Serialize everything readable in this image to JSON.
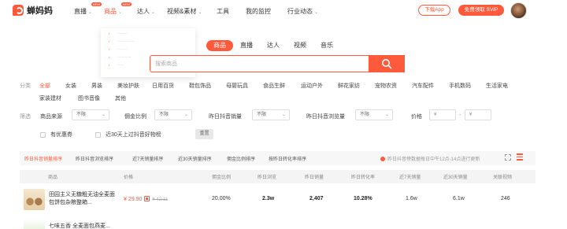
{
  "brand": {
    "name": "蝉妈妈",
    "accent": "#fe5a3b"
  },
  "nav": {
    "items": [
      {
        "label": "直播",
        "badge": "NEW"
      },
      {
        "label": "商品",
        "badge": "NEW"
      },
      {
        "label": "达人",
        "badge": ""
      },
      {
        "label": "视频&素材",
        "badge": ""
      },
      {
        "label": "工具",
        "badge": ""
      },
      {
        "label": "我的监控",
        "badge": ""
      },
      {
        "label": "行业动态",
        "badge": ""
      }
    ],
    "download_label": "下载App",
    "vip_label": "免费领取 SVIP"
  },
  "search": {
    "tabs": [
      "商品",
      "直播",
      "达人",
      "视频",
      "音乐"
    ],
    "placeholder": "搜索商品"
  },
  "category": {
    "label": "分类",
    "items": [
      "全部",
      "女装",
      "男装",
      "美妆护肤",
      "日用百货",
      "鞋包饰品",
      "母婴玩具",
      "食品生鲜",
      "运动户外",
      "鲜花家纺",
      "宠物农资",
      "汽车配件",
      "手机数码",
      "生活家电",
      "家装建材",
      "图书音像",
      "其他"
    ]
  },
  "filters": {
    "label": "筛选",
    "source_label": "商品来源",
    "source_value": "不限",
    "commission_label": "佣金比例",
    "commission_value": "不限",
    "sales_label": "昨日抖音销量",
    "sales_value": "不限",
    "views_label": "昨日抖音浏览量",
    "views_value": "不限",
    "price_label": "价格",
    "price_min": "¥",
    "price_max": "¥",
    "coupon_label": "有优惠券",
    "hot_label": "近30天上过抖音好物榜",
    "reset_label": "重置"
  },
  "sort": {
    "tabs": [
      "昨日抖音销量排序",
      "昨日抖音浏览排序",
      "近7天销量排序",
      "近30天销量排序",
      "佣金比例排序",
      "按昨日转化率排序"
    ],
    "note": "昨日抖音榜数据每日中午12点-14点进行更新"
  },
  "table": {
    "headers": [
      "商品",
      "价格",
      "佣金比例",
      "昨日浏览",
      "昨日销量",
      "昨日转化率",
      "近7天销量",
      "近30天销量",
      "关联视频"
    ],
    "rows": [
      {
        "name": "田园主义无糖粗无油全麦面包饼包杂粮整箱...",
        "price": "¥ 29.90",
        "orig_price": "¥ 42.11",
        "commission": "20.00%",
        "views": "2.3w",
        "sales": "2,407",
        "conversion": "10.28%",
        "sales7": "1.6w",
        "sales30": "6.1w",
        "videos": "246"
      },
      {
        "name": "七味五香 全麦面包燕麦...",
        "price": "",
        "orig_price": "",
        "commission": "",
        "views": "",
        "sales": "",
        "conversion": "",
        "sales7": "",
        "sales30": "",
        "videos": ""
      }
    ]
  }
}
